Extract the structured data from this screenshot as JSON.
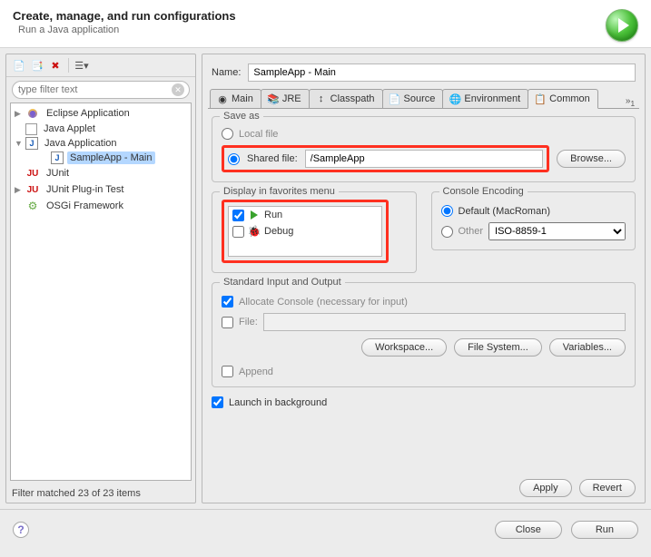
{
  "header": {
    "title": "Create, manage, and run configurations",
    "subtitle": "Run a Java application"
  },
  "toolbar": {
    "filter_placeholder": "type filter text"
  },
  "tree": {
    "items": [
      {
        "label": "Eclipse Application",
        "expandable": true,
        "expanded": false,
        "icon": "eclipse"
      },
      {
        "label": "Java Applet",
        "expandable": false,
        "icon": "applet"
      },
      {
        "label": "Java Application",
        "expandable": true,
        "expanded": true,
        "icon": "java",
        "children": [
          {
            "label": "SampleApp - Main",
            "icon": "java",
            "selected": true
          }
        ]
      },
      {
        "label": "JUnit",
        "expandable": false,
        "icon": "ju"
      },
      {
        "label": "JUnit Plug-in Test",
        "expandable": true,
        "expanded": false,
        "icon": "ju"
      },
      {
        "label": "OSGi Framework",
        "expandable": false,
        "icon": "osgi"
      }
    ],
    "filter_status": "Filter matched 23 of 23 items"
  },
  "config": {
    "name_label": "Name:",
    "name_value": "SampleApp - Main",
    "tabs": [
      "Main",
      "JRE",
      "Classpath",
      "Source",
      "Environment",
      "Common"
    ],
    "tabs_overflow": "»",
    "tabs_overflow_count": "1",
    "active_tab": "Common",
    "save_as": {
      "title": "Save as",
      "local_label": "Local file",
      "shared_label": "Shared file:",
      "shared_value": "/SampleApp",
      "browse_label": "Browse..."
    },
    "favorites": {
      "title": "Display in favorites menu",
      "items": [
        {
          "label": "Run",
          "checked": true,
          "icon": "play"
        },
        {
          "label": "Debug",
          "checked": false,
          "icon": "bug"
        }
      ]
    },
    "encoding": {
      "title": "Console Encoding",
      "default_label": "Default (MacRoman)",
      "other_label": "Other",
      "other_value": "ISO-8859-1"
    },
    "io": {
      "title": "Standard Input and Output",
      "allocate_label": "Allocate Console (necessary for input)",
      "file_label": "File:",
      "file_value": "",
      "workspace_label": "Workspace...",
      "filesystem_label": "File System...",
      "variables_label": "Variables...",
      "append_label": "Append"
    },
    "launch_bg_label": "Launch in background",
    "apply_label": "Apply",
    "revert_label": "Revert"
  },
  "footer": {
    "close_label": "Close",
    "run_label": "Run"
  }
}
